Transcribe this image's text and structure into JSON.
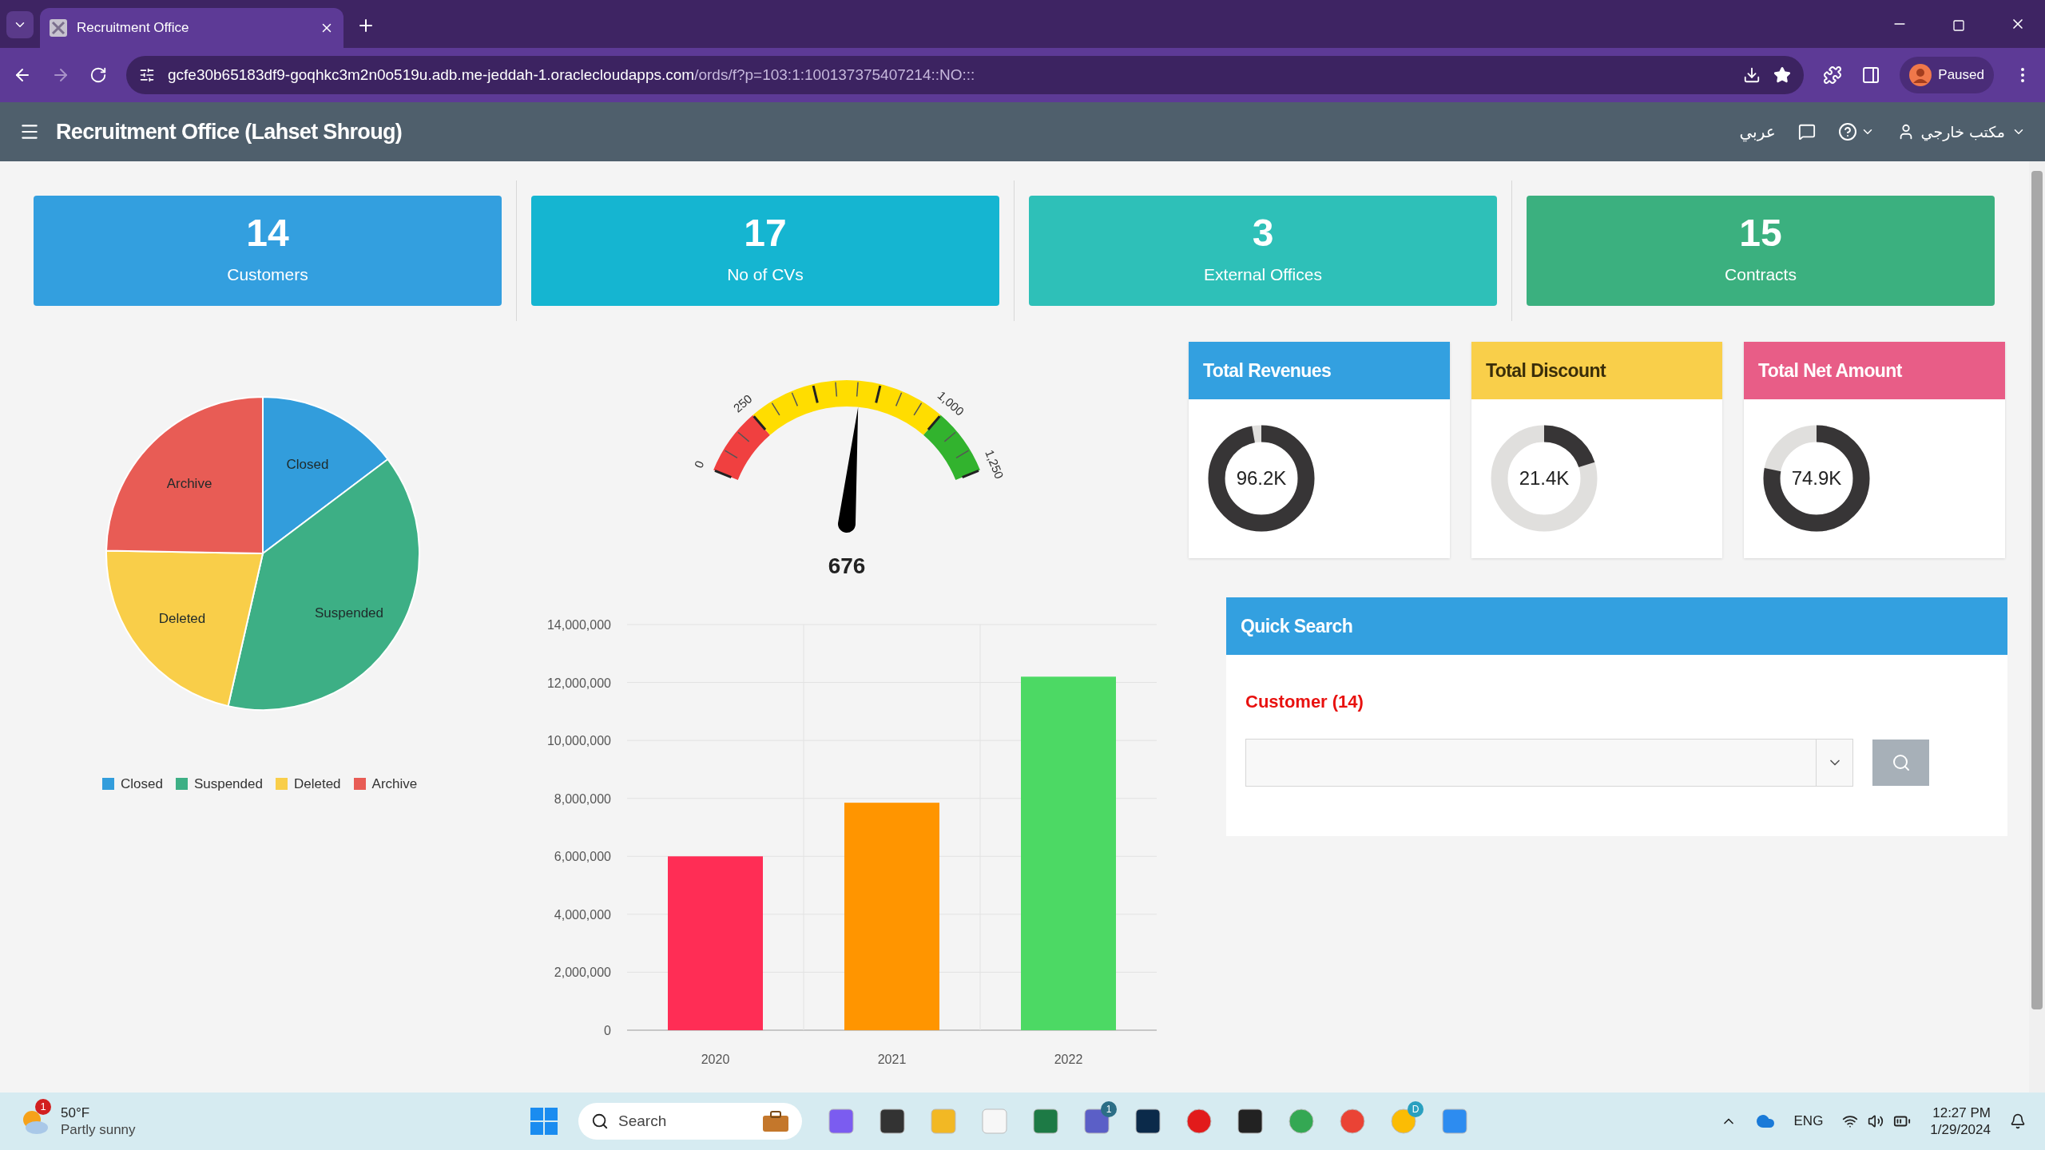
{
  "browser": {
    "tab_title": "Recruitment Office",
    "url_host": "gcfe30b65183df9-goqhkc3m2n0o519u.adb.me-jeddah-1.oraclecloudapps.com",
    "url_path": "/ords/f?p=103:1:100137375407214::NO:::",
    "profile": "Paused"
  },
  "header": {
    "title": "Recruitment Office (Lahset Shroug)",
    "language": "عربي",
    "user": "مكتب خارجي"
  },
  "stats": [
    {
      "value": "14",
      "label": "Customers",
      "color": "#339fdf"
    },
    {
      "value": "17",
      "label": "No of CVs",
      "color": "#15b5d1"
    },
    {
      "value": "3",
      "label": "External Offices",
      "color": "#2ec0b8"
    },
    {
      "value": "15",
      "label": "Contracts",
      "color": "#3bb07f"
    }
  ],
  "status_pie": {
    "slices": [
      {
        "label": "Closed",
        "color": "#329ddc"
      },
      {
        "label": "Suspended",
        "color": "#3daf85"
      },
      {
        "label": "Deleted",
        "color": "#f9ce49"
      },
      {
        "label": "Archive",
        "color": "#e85c55"
      }
    ],
    "legend": [
      {
        "label": "Closed",
        "color": "#329ddc"
      },
      {
        "label": "Suspended",
        "color": "#3daf85"
      },
      {
        "label": "Deleted",
        "color": "#f9ce49"
      },
      {
        "label": "Archive",
        "color": "#e85c55"
      }
    ]
  },
  "gauge": {
    "ticks": [
      "0",
      "250",
      "1,000",
      "1,250"
    ],
    "level": 0.5408,
    "reading": "676"
  },
  "bar_chart": {
    "bars": [
      {
        "color": "#ff2d55"
      },
      {
        "color": "#ff9500"
      },
      {
        "color": "#4cd964"
      }
    ],
    "chart_data": {
      "type": "bar",
      "grid": true,
      "categories": [
        "2020",
        "2021",
        "2022"
      ],
      "values": [
        6000000,
        7850000,
        12200000
      ],
      "ylim": [
        0,
        14000000
      ],
      "yticks": [
        {
          "value": 0,
          "label": "0"
        },
        {
          "value": 2000000,
          "label": "2,000,000"
        },
        {
          "value": 4000000,
          "label": "4,000,000"
        },
        {
          "value": 6000000,
          "label": "6,000,000"
        },
        {
          "value": 8000000,
          "label": "8,000,000"
        },
        {
          "value": 10000000,
          "label": "10,000,000"
        },
        {
          "value": 12000000,
          "label": "12,000,000"
        },
        {
          "value": 14000000,
          "label": "14,000,000"
        }
      ]
    }
  },
  "totals": [
    {
      "title": "Total Revenues",
      "color": "#33a0e0",
      "dark_title": false,
      "reading": "96.2K",
      "level": 0.97
    },
    {
      "title": "Total Discount",
      "color": "#f9cf4a",
      "dark_title": true,
      "reading": "21.4K",
      "level": 0.2
    },
    {
      "title": "Total Net Amount",
      "color": "#e85d87",
      "dark_title": false,
      "reading": "74.9K",
      "level": 0.78
    }
  ],
  "quick_search": {
    "title": "Quick Search",
    "field_label": "Customer (14)"
  },
  "taskbar": {
    "weather": {
      "temp": "50°F",
      "condition": "Partly sunny",
      "badge": "1"
    },
    "search": {
      "placeholder": "Search"
    },
    "teams_badge": "1",
    "chrome_badge": "D",
    "language": "ENG",
    "time": "12:27 PM",
    "date": "1/29/2024"
  }
}
